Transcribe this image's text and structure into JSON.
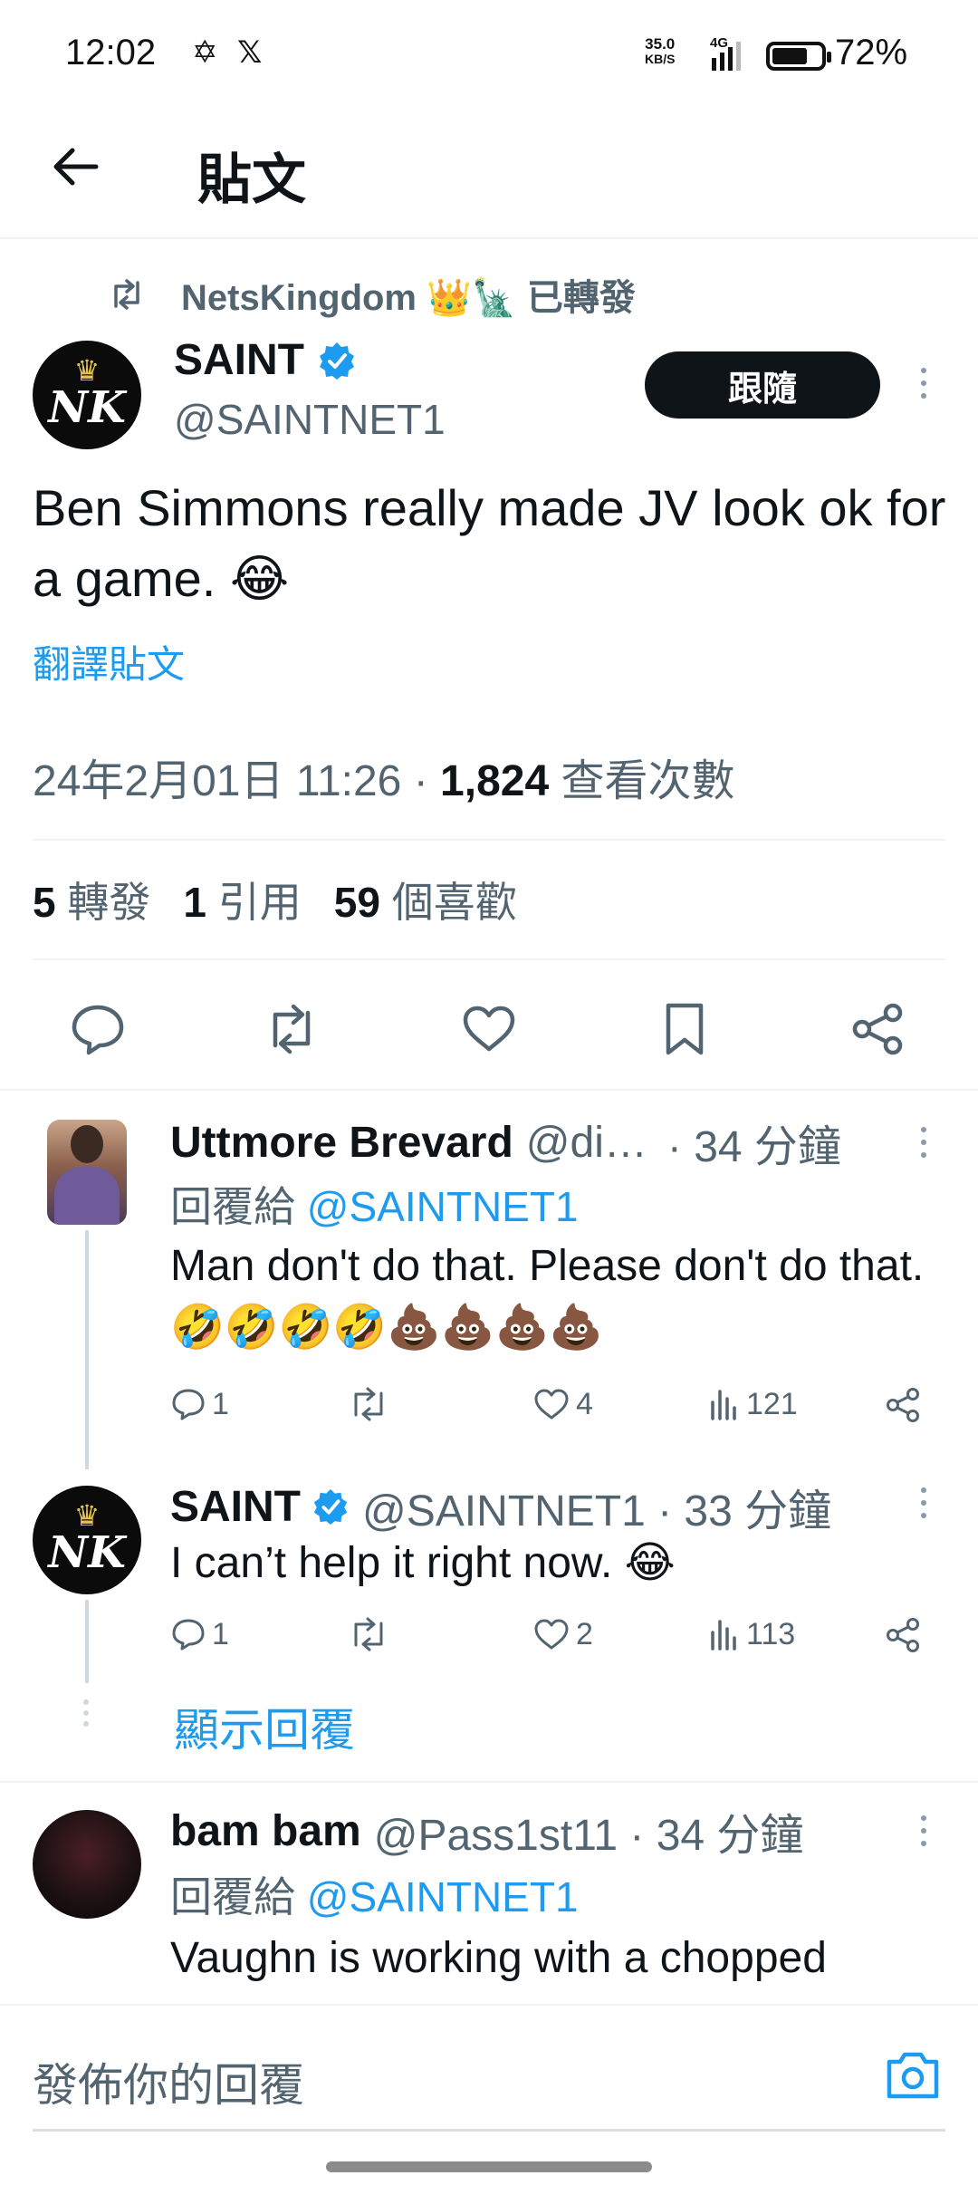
{
  "status_bar": {
    "time": "12:02",
    "speed_value": "35.0",
    "speed_unit": "KB/S",
    "network": "4G",
    "battery": "72%",
    "battery_level": 0.72
  },
  "header": {
    "title": "貼文"
  },
  "main_post": {
    "reposted_by": "NetsKingdom 👑🗽 已轉發",
    "author_name": "SAINT",
    "author_handle": "@SAINTNET1",
    "follow_label": "跟隨",
    "text": "Ben Simmons really made JV look ok for a game. 😂",
    "translate_label": "翻譯貼文",
    "timestamp": "24年2月01日 11:26 · ",
    "views_count": "1,824",
    "views_label": " 查看次數",
    "stats": {
      "reposts_count": "5",
      "reposts_label": "轉發",
      "quotes_count": "1",
      "quotes_label": "引用",
      "likes_count": "59",
      "likes_label": "個喜歡"
    }
  },
  "replies": [
    {
      "name": "Uttmore Brevard",
      "handle": "@di…",
      "time": "· 34 分鐘",
      "reply_to_prefix": "回覆給 ",
      "reply_to_handle": "@SAINTNET1",
      "text": "Man don't do that. Please don't do that. 🤣🤣🤣🤣💩💩💩💩",
      "replies": "1",
      "reposts": "",
      "likes": "4",
      "views": "121"
    },
    {
      "name": "SAINT",
      "handle": "@SAINTNET1 · 33 分鐘",
      "text": "I can’t help it right now. 😂",
      "replies": "1",
      "reposts": "",
      "likes": "2",
      "views": "113",
      "show_replies": "顯示回覆"
    },
    {
      "name": "bam bam",
      "handle": "@Pass1st11 · 34 分鐘",
      "reply_to_prefix": "回覆給 ",
      "reply_to_handle": "@SAINTNET1",
      "text": "Vaughn is working with a chopped"
    }
  ],
  "composer": {
    "placeholder": "發佈你的回覆"
  },
  "colors": {
    "accent": "#1d9bf0",
    "text": "#0f1419",
    "muted": "#536471",
    "follow_bg": "#0f1419"
  },
  "icons": [
    "back-arrow-icon",
    "repost-icon",
    "verified-badge-icon",
    "more-icon",
    "reply-icon",
    "like-icon",
    "bookmark-icon",
    "share-icon",
    "views-icon",
    "camera-icon"
  ]
}
